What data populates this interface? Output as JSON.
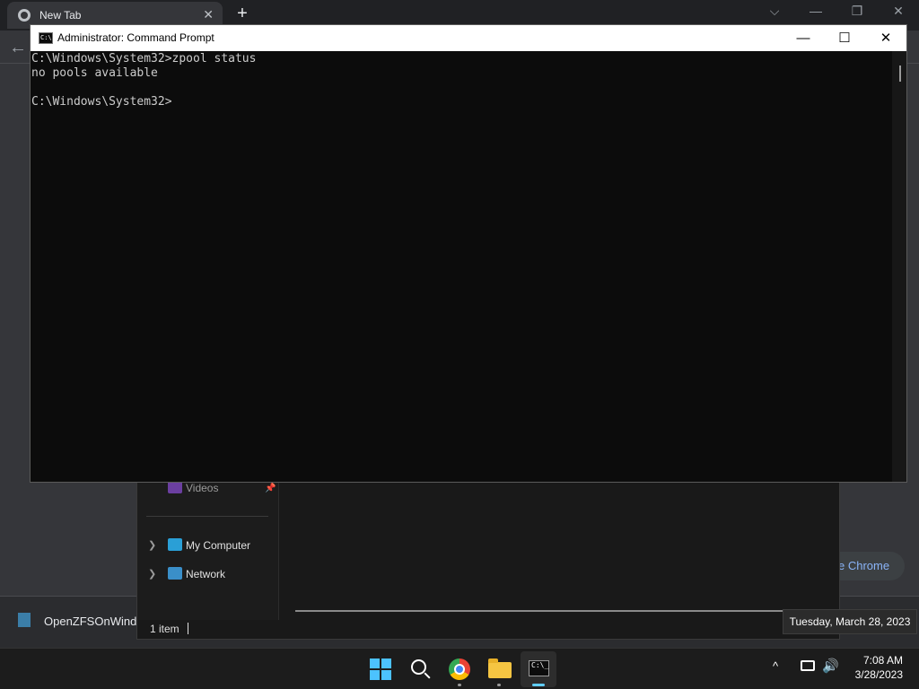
{
  "chrome": {
    "tab_title": "New Tab",
    "tab_close": "✕",
    "new_tab": "+",
    "controls": {
      "list": "⌵",
      "minimize": "—",
      "restore": "❐",
      "close": "✕"
    },
    "back": "←",
    "set_default_pill": "e Chrome",
    "download_label": "OpenZFSOnWindc"
  },
  "explorer": {
    "nav_items": [
      {
        "label": "Videos"
      },
      {
        "label": "My Computer"
      },
      {
        "label": "Network"
      }
    ],
    "status": "1 item"
  },
  "tooltip": {
    "date_full": "Tuesday, March 28, 2023"
  },
  "cmd": {
    "title": "Administrator: Command Prompt",
    "icon_text": "C:\\",
    "controls": {
      "minimize": "—",
      "maximize": "☐",
      "close": "✕"
    },
    "lines": [
      "C:\\Windows\\System32>zpool status",
      "no pools available",
      "",
      "C:\\Windows\\System32>"
    ]
  },
  "taskbar": {
    "apps": [
      "start",
      "search",
      "chrome",
      "file-explorer",
      "terminal"
    ],
    "term_icon_text": "C:\\_",
    "tray_chevron": "^",
    "volume_icon": "🔊",
    "time": "7:08 AM",
    "date": "3/28/2023"
  },
  "colors": {
    "cmd_bg": "#0c0c0c",
    "cmd_text": "#cccccc",
    "accent": "#60cdff",
    "taskbar_bg": "#1c1c1c"
  }
}
